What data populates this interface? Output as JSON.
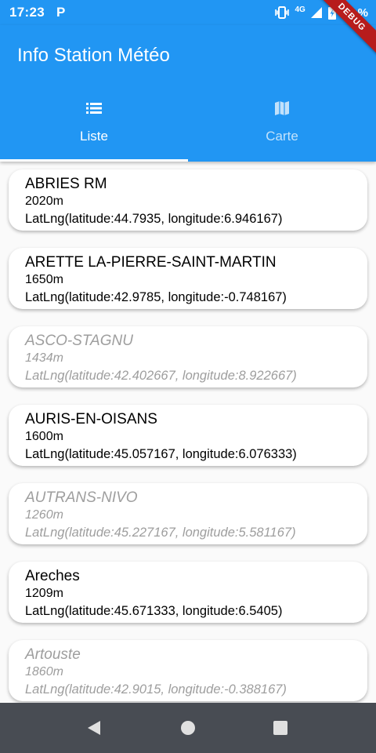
{
  "status_bar": {
    "time": "17:23",
    "app_icon_letter": "P",
    "network": "4G",
    "battery": "65 %"
  },
  "debug_banner": "DEBUG",
  "app_bar": {
    "title": "Info Station Météo",
    "tabs": [
      {
        "label": "Liste",
        "icon": "list-icon",
        "selected": true
      },
      {
        "label": "Carte",
        "icon": "map-icon",
        "selected": false
      }
    ]
  },
  "stations": [
    {
      "name": "ABRIES RM",
      "altitude": "2020m",
      "coords": "LatLng(latitude:44.7935, longitude:6.946167)",
      "active": true
    },
    {
      "name": "ARETTE LA-PIERRE-SAINT-MARTIN",
      "altitude": "1650m",
      "coords": "LatLng(latitude:42.9785, longitude:-0.748167)",
      "active": true
    },
    {
      "name": "ASCO-STAGNU",
      "altitude": "1434m",
      "coords": "LatLng(latitude:42.402667, longitude:8.922667)",
      "active": false
    },
    {
      "name": "AURIS-EN-OISANS",
      "altitude": "1600m",
      "coords": "LatLng(latitude:45.057167, longitude:6.076333)",
      "active": true
    },
    {
      "name": "AUTRANS-NIVO",
      "altitude": "1260m",
      "coords": "LatLng(latitude:45.227167, longitude:5.581167)",
      "active": false
    },
    {
      "name": "Areches",
      "altitude": "1209m",
      "coords": "LatLng(latitude:45.671333, longitude:6.5405)",
      "active": true
    },
    {
      "name": "Artouste",
      "altitude": "1860m",
      "coords": "LatLng(latitude:42.9015, longitude:-0.388167)",
      "active": false
    }
  ],
  "nav_bar": {
    "buttons": [
      "back-icon",
      "home-icon",
      "recents-icon"
    ]
  }
}
